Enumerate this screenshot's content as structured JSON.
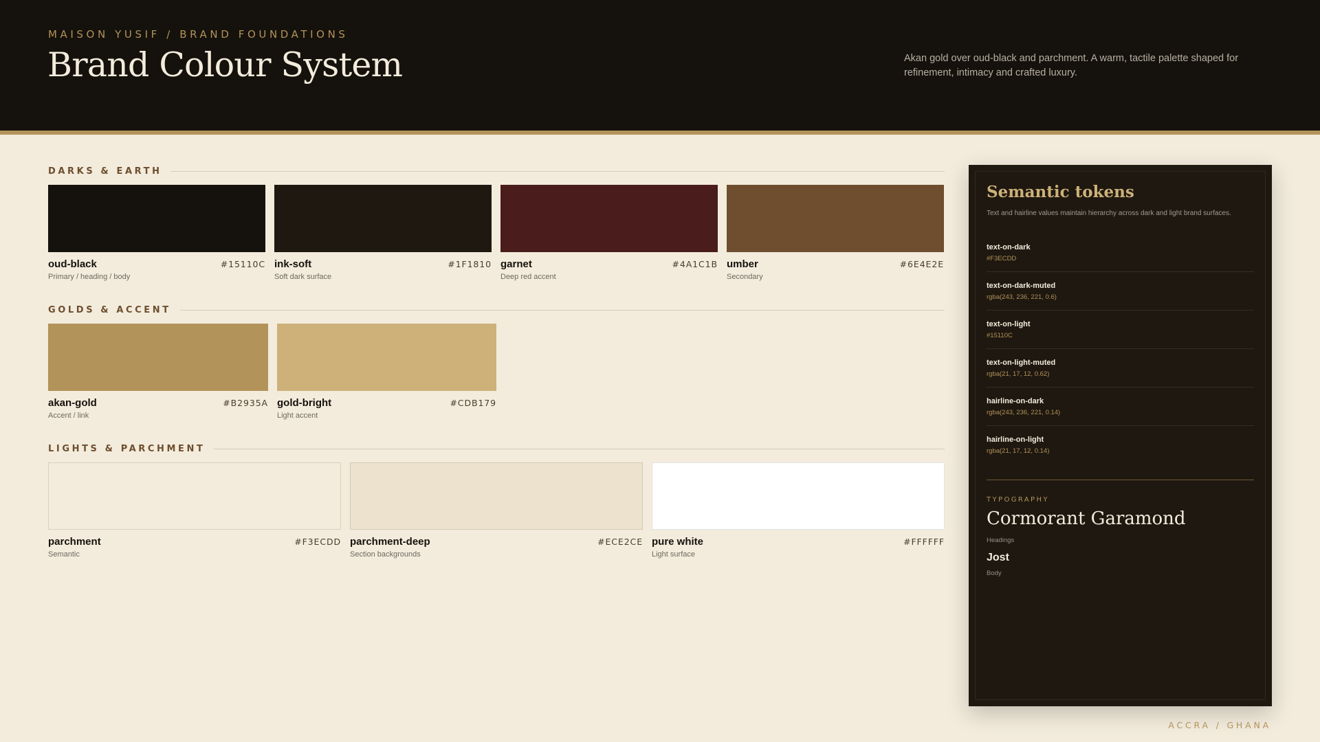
{
  "header": {
    "eyebrow": "MAISON YUSIF / BRAND FOUNDATIONS",
    "title": "Brand Colour System",
    "description": "Akan gold over oud-black and parchment. A warm, tactile palette shaped for refinement, intimacy and crafted luxury."
  },
  "groups": [
    {
      "title": "DARKS & EARTH",
      "swatches": [
        {
          "name": "oud-black",
          "hex": "#15110C",
          "color": "#15110C",
          "role": "Primary / heading / body"
        },
        {
          "name": "ink-soft",
          "hex": "#1F1810",
          "color": "#1F1810",
          "role": "Soft dark surface"
        },
        {
          "name": "garnet",
          "hex": "#4A1C1B",
          "color": "#4A1C1B",
          "role": "Deep red accent"
        },
        {
          "name": "umber",
          "hex": "#6E4E2E",
          "color": "#6E4E2E",
          "role": "Secondary"
        }
      ]
    },
    {
      "title": "GOLDS & ACCENT",
      "swatches": [
        {
          "name": "akan-gold",
          "hex": "#B2935A",
          "color": "#B2935A",
          "role": "Accent / link"
        },
        {
          "name": "gold-bright",
          "hex": "#CDB179",
          "color": "#CDB179",
          "role": "Light accent"
        }
      ]
    },
    {
      "title": "LIGHTS & PARCHMENT",
      "swatches": [
        {
          "name": "parchment",
          "hex": "#F3ECDD",
          "color": "#F3ECDD",
          "role": "Semantic"
        },
        {
          "name": "parchment-deep",
          "hex": "#ECE2CE",
          "color": "#ECE2CE",
          "role": "Section backgrounds"
        },
        {
          "name": "pure white",
          "hex": "#FFFFFF",
          "color": "#FFFFFF",
          "role": "Light surface"
        }
      ]
    }
  ],
  "panel": {
    "title": "Semantic tokens",
    "subtitle": "Text and hairline values maintain hierarchy across dark and light brand surfaces.",
    "tokens": [
      {
        "name": "text-on-dark",
        "value": "#F3ECDD"
      },
      {
        "name": "text-on-dark-muted",
        "value": "rgba(243, 236, 221, 0.6)"
      },
      {
        "name": "text-on-light",
        "value": "#15110C"
      },
      {
        "name": "text-on-light-muted",
        "value": "rgba(21, 17, 12, 0.62)"
      },
      {
        "name": "hairline-on-dark",
        "value": "rgba(243, 236, 221, 0.14)"
      },
      {
        "name": "hairline-on-light",
        "value": "rgba(21, 17, 12, 0.14)"
      }
    ],
    "typography": {
      "label": "TYPOGRAPHY",
      "heading_font": "Cormorant Garamond",
      "heading_use": "Headings",
      "body_font": "Jost",
      "body_use": "Body"
    }
  },
  "footer": {
    "location": "ACCRA / GHANA"
  }
}
